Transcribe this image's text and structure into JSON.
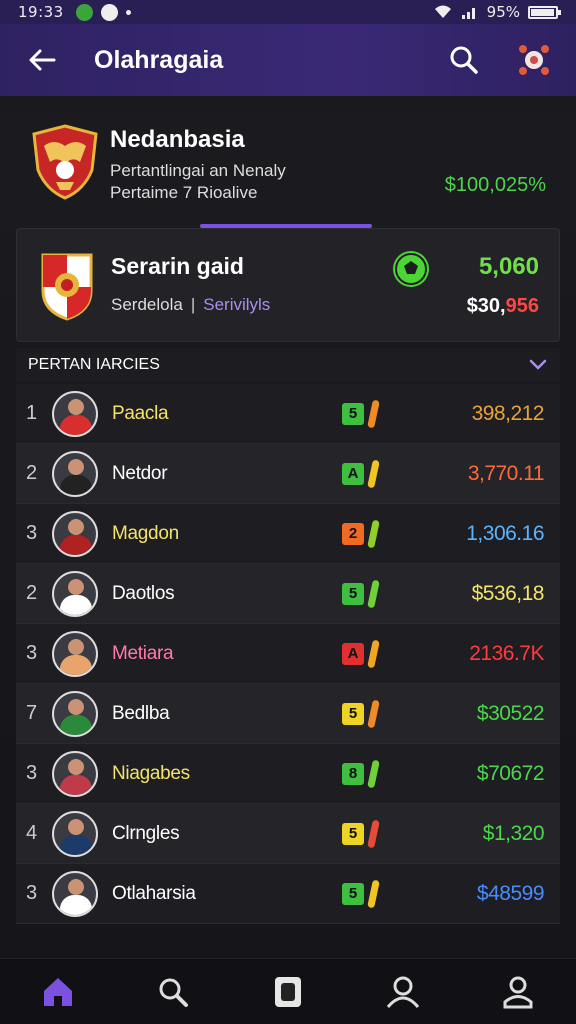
{
  "status_bar": {
    "time": "19:33",
    "battery": "95%",
    "battery_level": 0.95
  },
  "app_bar": {
    "title": "Olahragaia",
    "back_icon": "arrow-left-icon",
    "search_icon": "search-icon",
    "menu_icon": "ball-icon"
  },
  "team": {
    "name": "Nedanbasia",
    "subtitle_line1": "Pertantlingai an Nenaly",
    "subtitle_line2": "Pertaime 7 Rioalive",
    "value": "$100,025%"
  },
  "featured": {
    "title": "Serarin gaid",
    "sub_left": "Serdelola",
    "sub_sep": "|",
    "sub_link": "Serivilyls",
    "value_primary": "5,060",
    "value_secondary_a": "$30,",
    "value_secondary_b": "956"
  },
  "section": {
    "title": "PERTAN IARCIES"
  },
  "players": [
    {
      "rank": "1",
      "name": "Paacla",
      "name_color": "#f3e36a",
      "grade": "5",
      "grade_color": "#3fbf3f",
      "stick_color": "#f08a24",
      "value": "398,212",
      "value_color": "#e8a23c",
      "jersey": "#d92e2e"
    },
    {
      "rank": "2",
      "name": "Netdor",
      "name_color": "#ffffff",
      "grade": "A",
      "grade_color": "#3fbf3f",
      "stick_color": "#f0c424",
      "value": "3,770.11",
      "value_color": "#ff6a3a",
      "jersey": "#222222"
    },
    {
      "rank": "3",
      "name": "Magdon",
      "name_color": "#f3e36a",
      "grade": "2",
      "grade_color": "#f06a24",
      "stick_color": "#8fcf2a",
      "value": "1,306.16",
      "value_color": "#5ab4ff",
      "jersey": "#b02222"
    },
    {
      "rank": "2",
      "name": "Daotlos",
      "name_color": "#ffffff",
      "grade": "5",
      "grade_color": "#3fbf3f",
      "stick_color": "#6ed13a",
      "value": "$536,18",
      "value_color": "#f3e36a",
      "jersey": "#ffffff"
    },
    {
      "rank": "3",
      "name": "Metiara",
      "name_color": "#ff7aa8",
      "grade": "A",
      "grade_color": "#e03030",
      "stick_color": "#f0a624",
      "value": "2136.7K",
      "value_color": "#ff3b3b",
      "jersey": "#e8a46a"
    },
    {
      "rank": "7",
      "name": "Bedlba",
      "name_color": "#ffffff",
      "grade": "5",
      "grade_color": "#f0d424",
      "stick_color": "#f08a24",
      "value": "$30522",
      "value_color": "#4bd64b",
      "jersey": "#2a8a3a"
    },
    {
      "rank": "3",
      "name": "Niagabes",
      "name_color": "#f3e36a",
      "grade": "8",
      "grade_color": "#3fbf3f",
      "stick_color": "#6ed13a",
      "value": "$70672",
      "value_color": "#4bd64b",
      "jersey": "#c03a4a"
    },
    {
      "rank": "4",
      "name": "Clrngles",
      "name_color": "#ffffff",
      "grade": "5",
      "grade_color": "#f0d424",
      "stick_color": "#e84a3a",
      "value": "$1,320",
      "value_color": "#4bd64b",
      "jersey": "#1c3a6a"
    },
    {
      "rank": "3",
      "name": "Otlaharsia",
      "name_color": "#ffffff",
      "grade": "5",
      "grade_color": "#3fbf3f",
      "stick_color": "#f0c424",
      "value": "$48599",
      "value_color": "#4a8cff",
      "jersey": "#ffffff"
    }
  ],
  "bottom_nav": [
    {
      "name": "home",
      "icon": "home-icon",
      "active": true
    },
    {
      "name": "search",
      "icon": "search-icon",
      "active": false
    },
    {
      "name": "cards",
      "icon": "card-icon",
      "active": false
    },
    {
      "name": "people",
      "icon": "user-outline-icon",
      "active": false
    },
    {
      "name": "profile",
      "icon": "profile-icon",
      "active": false
    }
  ],
  "colors": {
    "accent": "#7b52e0",
    "appbar": "#35256e",
    "positive": "#4bd64b"
  }
}
